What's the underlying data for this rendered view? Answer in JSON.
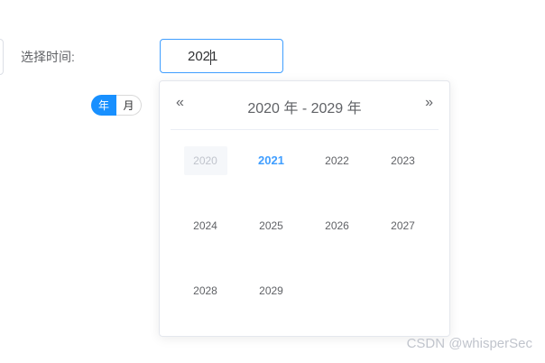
{
  "form": {
    "label": "选择时间:",
    "input_value": "2021"
  },
  "mode_toggle": {
    "year_label": "年",
    "month_label": "月",
    "selected": "年"
  },
  "picker": {
    "prev_icon": "«",
    "next_icon": "»",
    "header": "2020 年 - 2029 年",
    "years": [
      {
        "label": "2020",
        "state": "disabled"
      },
      {
        "label": "2021",
        "state": "current"
      },
      {
        "label": "2022",
        "state": "normal"
      },
      {
        "label": "2023",
        "state": "normal"
      },
      {
        "label": "2024",
        "state": "normal"
      },
      {
        "label": "2025",
        "state": "normal"
      },
      {
        "label": "2026",
        "state": "normal"
      },
      {
        "label": "2027",
        "state": "normal"
      },
      {
        "label": "2028",
        "state": "normal"
      },
      {
        "label": "2029",
        "state": "normal"
      }
    ]
  },
  "colors": {
    "accent": "#409eff",
    "toggle_active": "#1890ff"
  },
  "watermark": "CSDN @whisperSec"
}
